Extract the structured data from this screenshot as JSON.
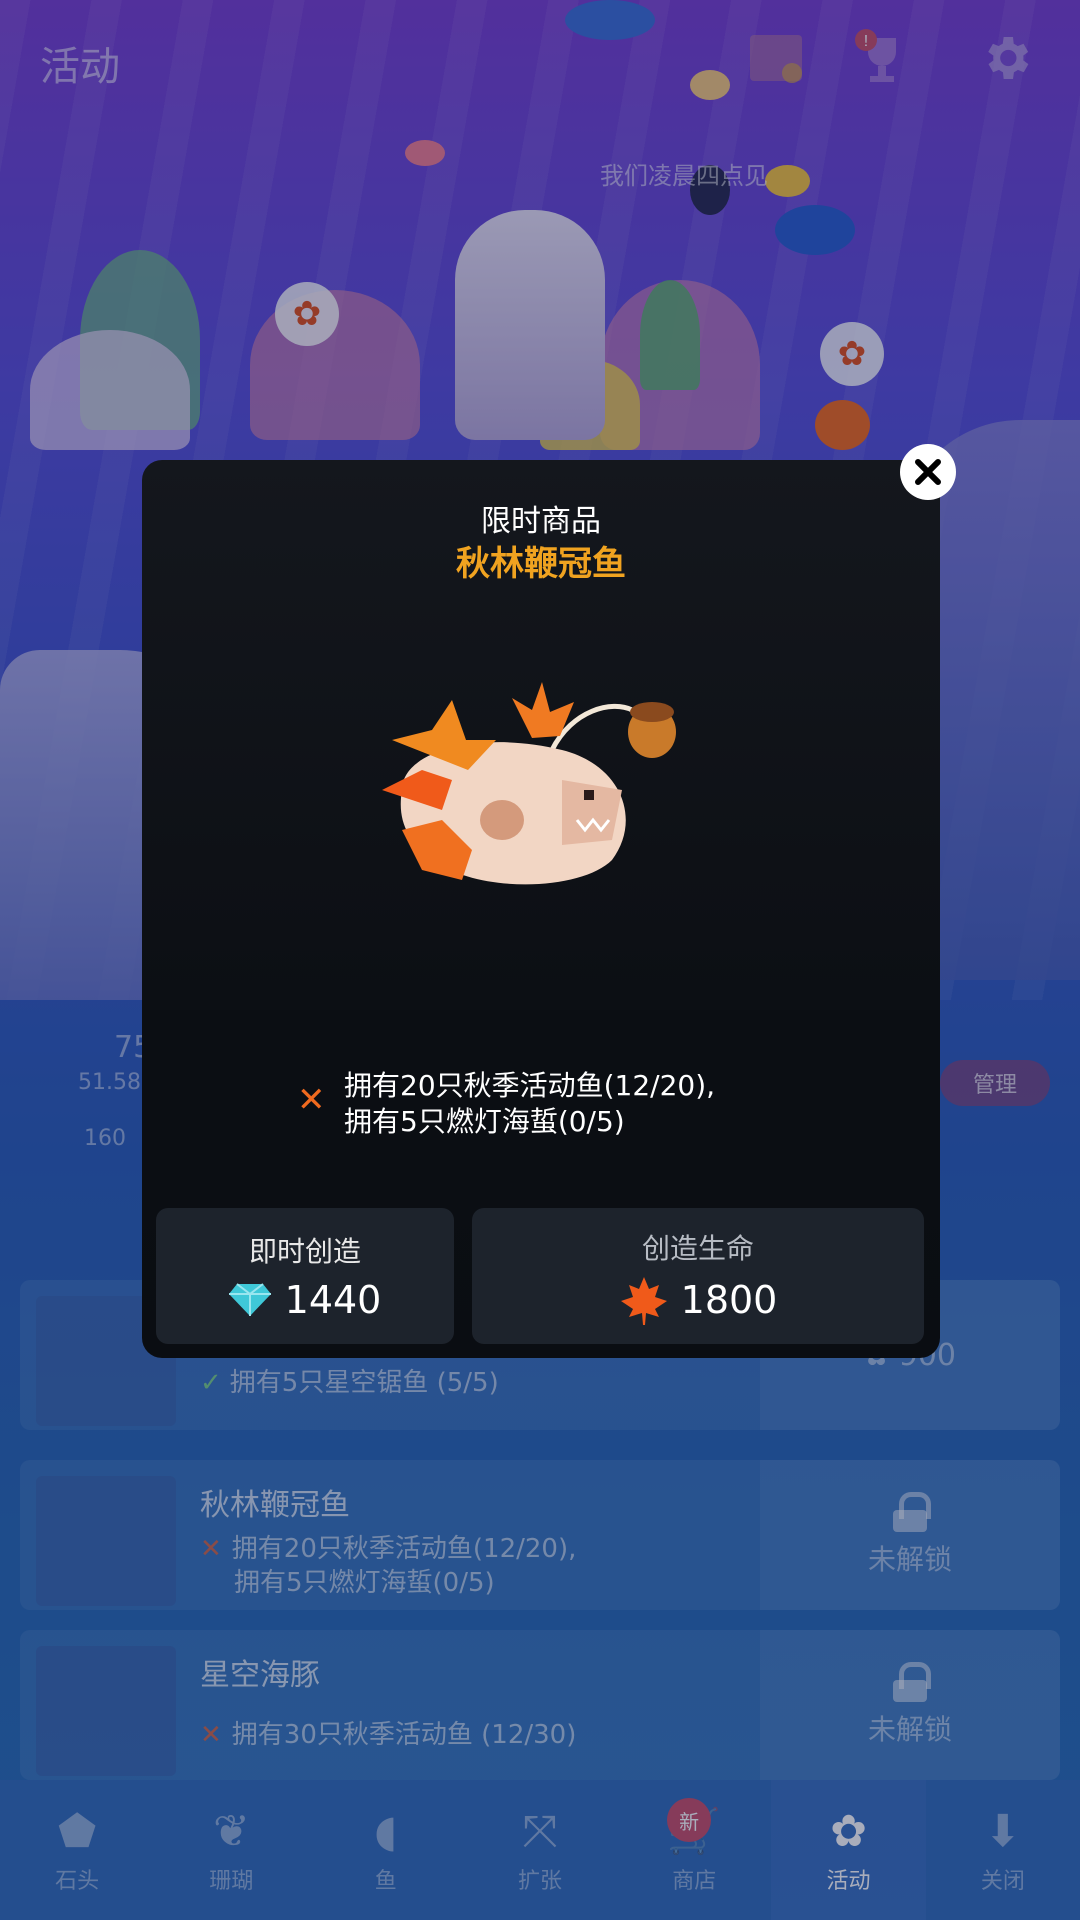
{
  "top": {
    "title": "活动",
    "notice": "我们凌晨四点见"
  },
  "stats": {
    "likes": "75",
    "taps": "51.58",
    "growth": "160",
    "manage_label": "管理"
  },
  "list": [
    {
      "name": "",
      "req_done": "拥有5只星空锯鱼 (5/5)",
      "price": "900"
    },
    {
      "name": "秋林鞭冠鱼",
      "req_line1": "拥有20只秋季活动鱼(12/20),",
      "req_line2": "拥有5只燃灯海蜇(0/5)",
      "lock_label": "未解锁"
    },
    {
      "name": "星空海豚",
      "req_line1": "拥有30只秋季活动鱼 (12/30)",
      "lock_label": "未解锁"
    }
  ],
  "nav": [
    {
      "label": "石头",
      "icon": "rock-icon"
    },
    {
      "label": "珊瑚",
      "icon": "coral-icon"
    },
    {
      "label": "鱼",
      "icon": "fish-icon"
    },
    {
      "label": "扩张",
      "icon": "expand-icon"
    },
    {
      "label": "商店",
      "icon": "cart-icon",
      "badge": "新"
    },
    {
      "label": "活动",
      "icon": "maple-leaf-icon",
      "active": true
    },
    {
      "label": "关闭",
      "icon": "down-arrow-icon"
    }
  ],
  "modal": {
    "title": "限时商品",
    "name": "秋林鞭冠鱼",
    "req_line1": "拥有20只秋季活动鱼(12/20),",
    "req_line2": "拥有5只燃灯海蜇(0/5)",
    "instant": {
      "label": "即时创造",
      "price": "1440",
      "currency": "gem-icon"
    },
    "create": {
      "label": "创造生命",
      "price": "1800",
      "currency": "maple-leaf-icon"
    }
  },
  "colors": {
    "accent_orange": "#f0a320",
    "fail_x": "#f06a1f",
    "gem": "#3fc8d8"
  }
}
